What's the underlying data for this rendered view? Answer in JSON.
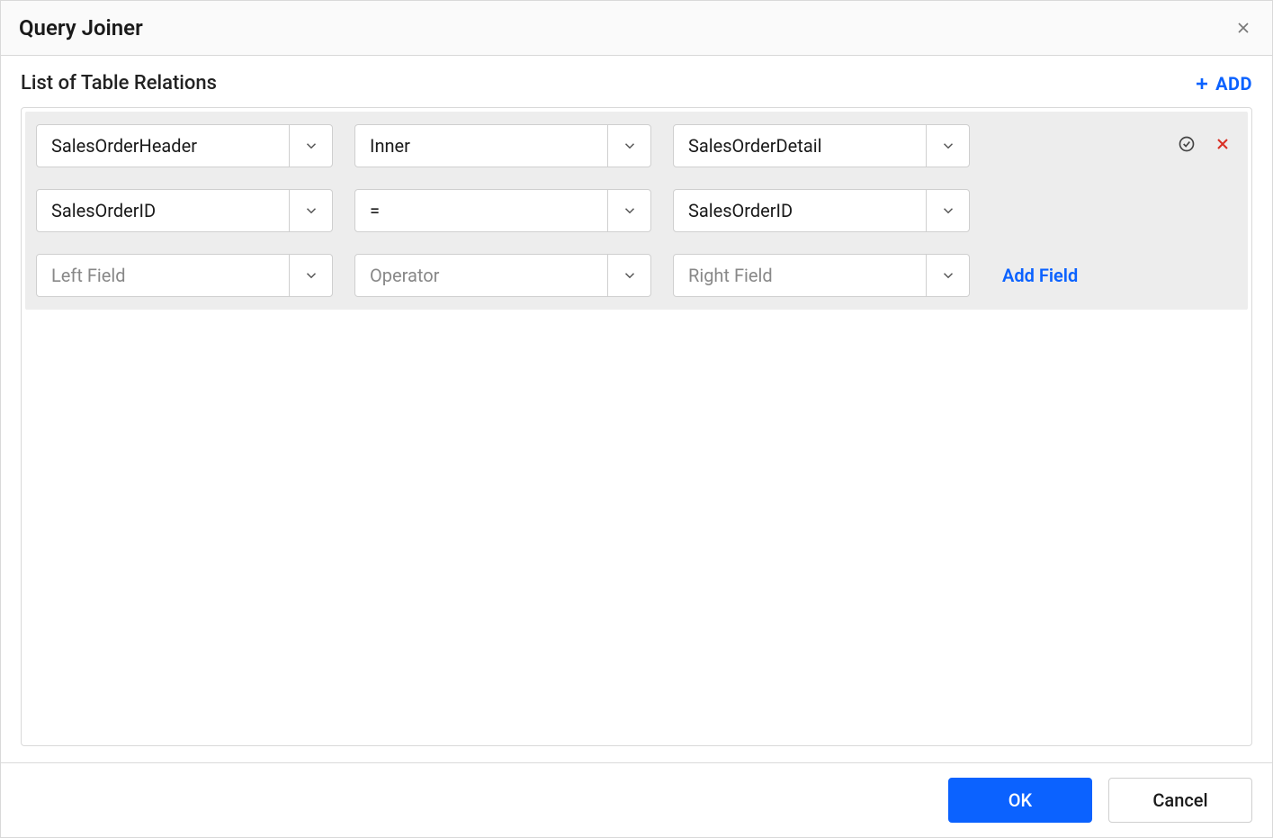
{
  "dialog": {
    "title": "Query Joiner"
  },
  "section": {
    "title": "List of Table Relations",
    "add_label": "ADD",
    "add_field_label": "Add Field"
  },
  "relation": {
    "left_table": "SalesOrderHeader",
    "join_type": "Inner",
    "right_table": "SalesOrderDetail",
    "conditions": [
      {
        "left_field": "SalesOrderID",
        "operator": "=",
        "right_field": "SalesOrderID"
      }
    ],
    "placeholders": {
      "left_field": "Left Field",
      "operator": "Operator",
      "right_field": "Right Field"
    }
  },
  "footer": {
    "ok": "OK",
    "cancel": "Cancel"
  }
}
